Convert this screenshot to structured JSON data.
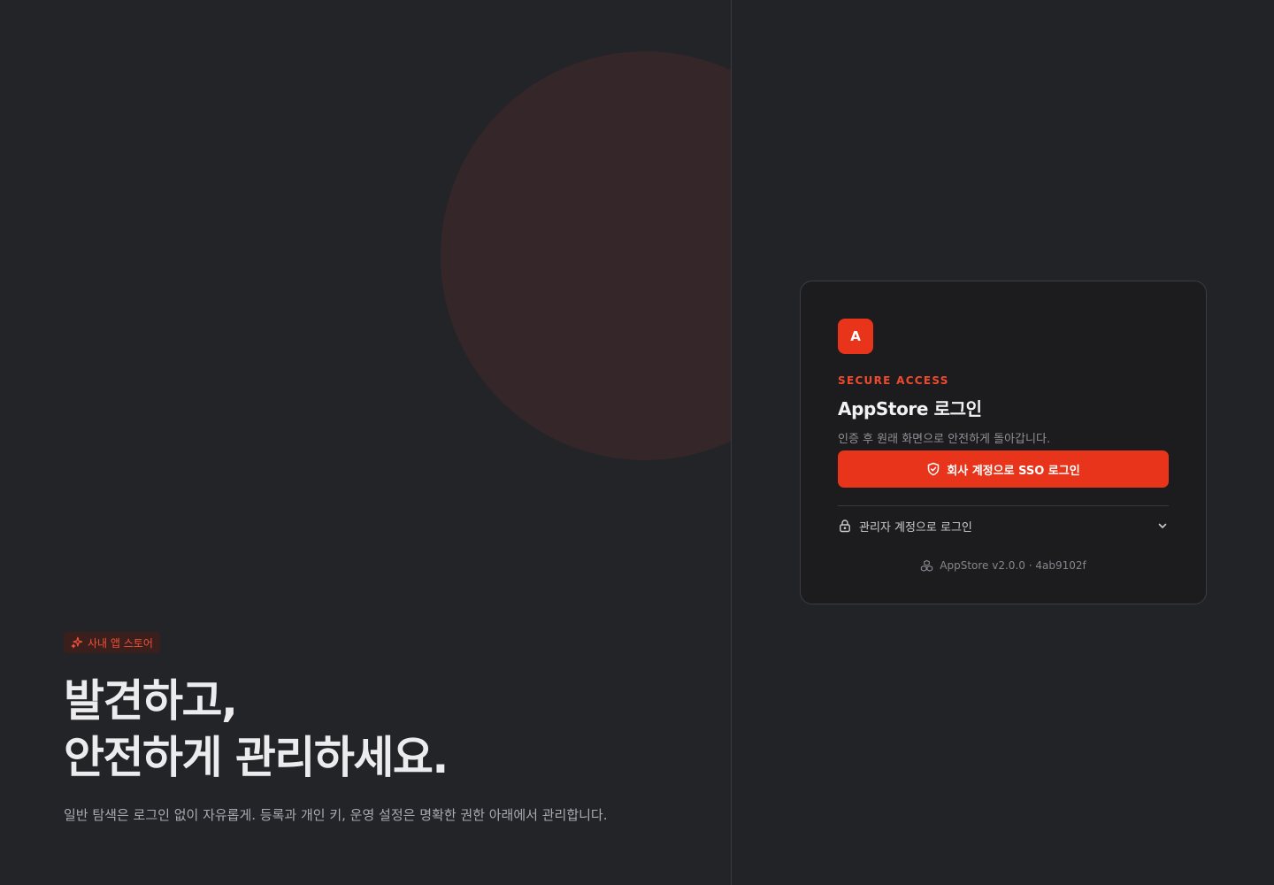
{
  "hero": {
    "badge_label": "사내 앱 스토어",
    "badge_icon": "sparkles-icon",
    "title_line1": "발견하고,",
    "title_line2": "안전하게 관리하세요.",
    "description": "일반 탐색은 로그인 없이 자유롭게. 등록과 개인 키, 운영 설정은 명확한 권한 아래에서 관리합니다."
  },
  "login_card": {
    "logo_letter": "A",
    "eyebrow": "SECURE ACCESS",
    "title": "AppStore 로그인",
    "subtitle": "인증 후 원래 화면으로 안전하게 돌아갑니다.",
    "sso_button_label": "회사 계정으로 SSO 로그인",
    "sso_button_icon": "shield-check-icon",
    "admin_toggle_label": "관리자 계정으로 로그인",
    "admin_toggle_icon": "lock-icon",
    "admin_toggle_chevron": "chevron-down-icon",
    "version_text": "AppStore v2.0.0 · 4ab9102f",
    "version_icon": "cubes-icon"
  },
  "colors": {
    "accent": "#e8341a",
    "eyebrow": "#f04a2e",
    "background": "#222327",
    "card_background": "#1c1c1f"
  }
}
